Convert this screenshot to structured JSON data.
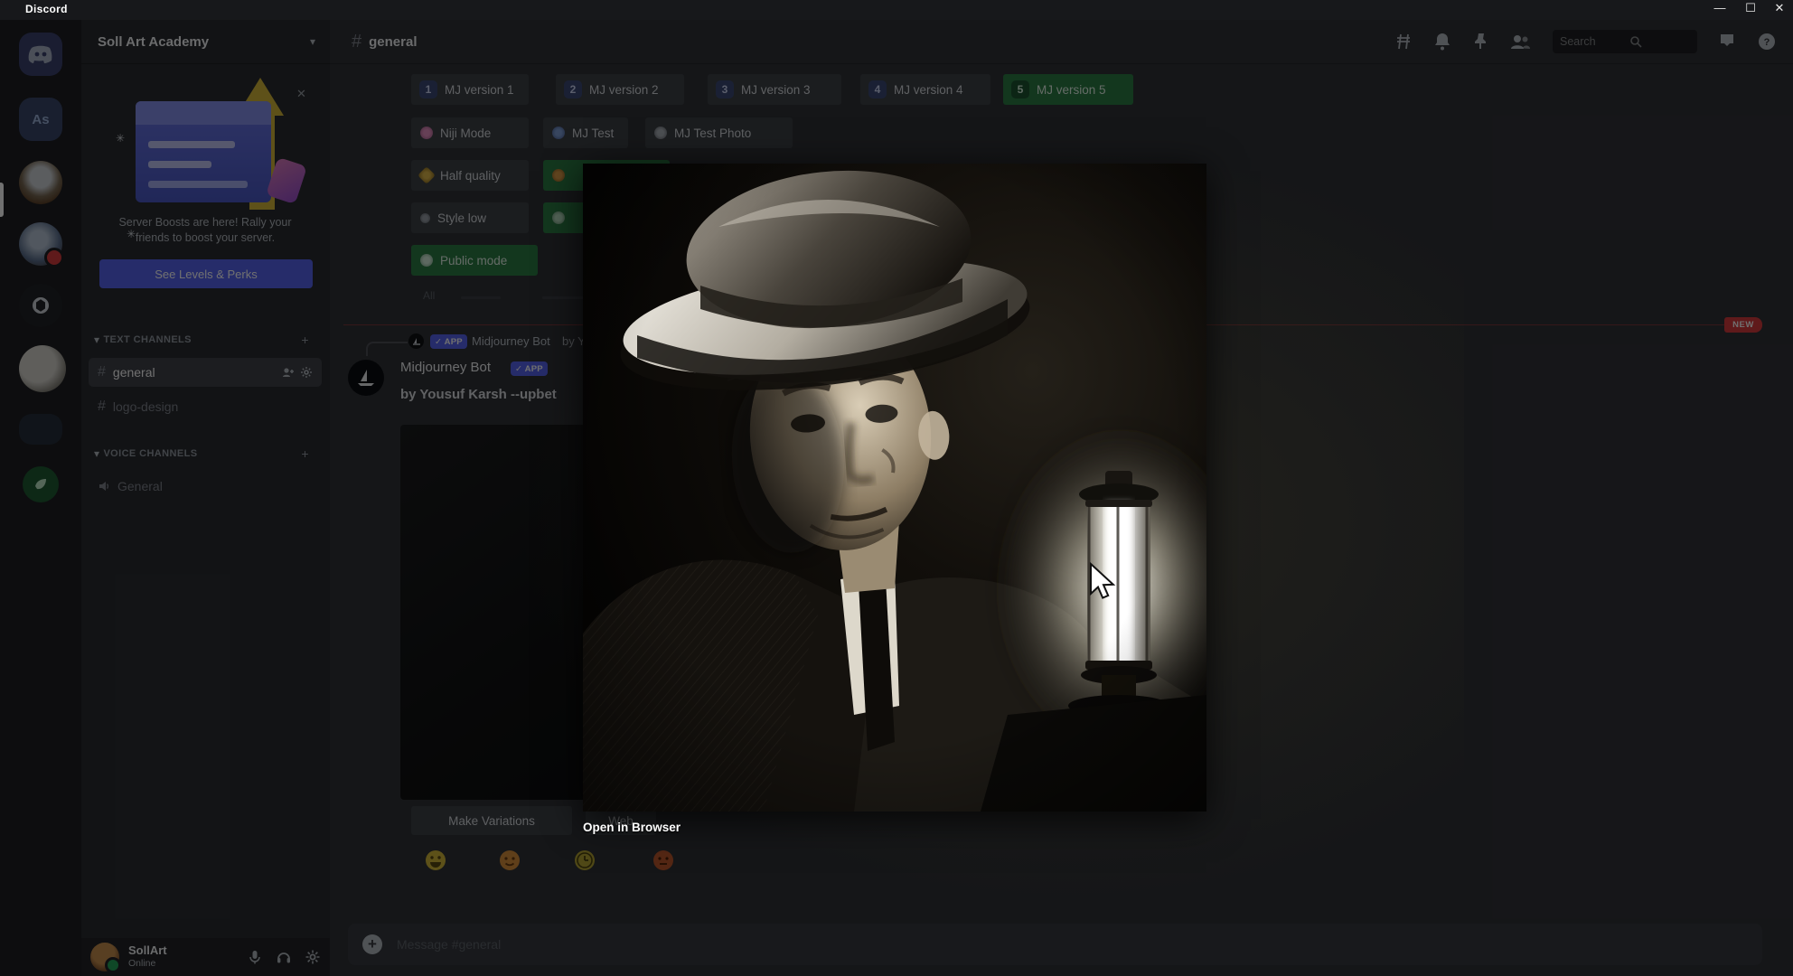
{
  "titlebar": {
    "app_name": "Discord"
  },
  "window_controls": {
    "minimize": "—",
    "maximize": "☐",
    "close": "✕"
  },
  "server_rail": {
    "home_icon": "discord-logo",
    "as_server_label": "As",
    "icons": [
      "art-academy-avatar",
      "wizard-avatar",
      "chatgpt-logo",
      "moon-art-avatar",
      "blue-server",
      "green-server"
    ]
  },
  "sidebar": {
    "server_name": "Soll Art Academy",
    "boost_card": {
      "line1": "Server Boosts are here! Rally your",
      "line2": "friends to boost your server.",
      "cta": "See Levels & Perks",
      "close_glyph": "✕"
    },
    "text_channels_label": "TEXT CHANNELS",
    "voice_channels_label": "VOICE CHANNELS",
    "add_glyph": "+",
    "chevron_glyph": "▾",
    "channels": [
      {
        "name": "general"
      },
      {
        "name": "logo-design"
      }
    ],
    "voice_channels": [
      {
        "name": "General"
      }
    ],
    "user": {
      "name": "SollArt",
      "status": "Online"
    }
  },
  "header": {
    "channel_name": "general",
    "hash_glyph": "#",
    "search_placeholder": "Search",
    "icons": [
      "threads-icon",
      "bell-icon",
      "pin-icon",
      "members-icon",
      "inbox-icon",
      "help-icon"
    ]
  },
  "settings": {
    "row1": [
      {
        "badge": "1",
        "label": "MJ version 1"
      },
      {
        "badge": "2",
        "label": "MJ version 2"
      },
      {
        "badge": "3",
        "label": "MJ version 3"
      },
      {
        "badge": "4",
        "label": "MJ version 4"
      },
      {
        "badge": "5",
        "label": "MJ version 5"
      }
    ],
    "row2": [
      {
        "label": "Niji Mode"
      },
      {
        "label": "MJ Test"
      },
      {
        "label": "MJ Test Photo"
      }
    ],
    "row3": [
      {
        "label": "Half quality"
      }
    ],
    "row4": [
      {
        "label": "Style low"
      }
    ],
    "row5": [
      {
        "label": "Public mode"
      }
    ],
    "footer": "All"
  },
  "message": {
    "new_badge": "NEW",
    "reply_app_badge": "✓ APP",
    "reply_author": "Midjourney Bot",
    "reply_preview": "by Yousuf Karsh --upbet",
    "author": "Midjourney Bot",
    "app_badge": "✓ APP",
    "content": "by Yousuf Karsh --upbet",
    "make_variations_label": "Make Variations",
    "web_label": "Web",
    "reactions": [
      "grinning-face-emoji",
      "orange-face-emoji",
      "clock-face-emoji",
      "brown-face-emoji"
    ]
  },
  "composer": {
    "placeholder": "Message #general",
    "plus_glyph": "+"
  },
  "lightbox": {
    "open_in_browser": "Open in Browser"
  },
  "colors": {
    "blurple": "#5865f2",
    "success_green": "#2d7d46",
    "danger_red": "#d83c3e",
    "sidebar": "#2b2d31",
    "chat_bg": "#313338"
  }
}
